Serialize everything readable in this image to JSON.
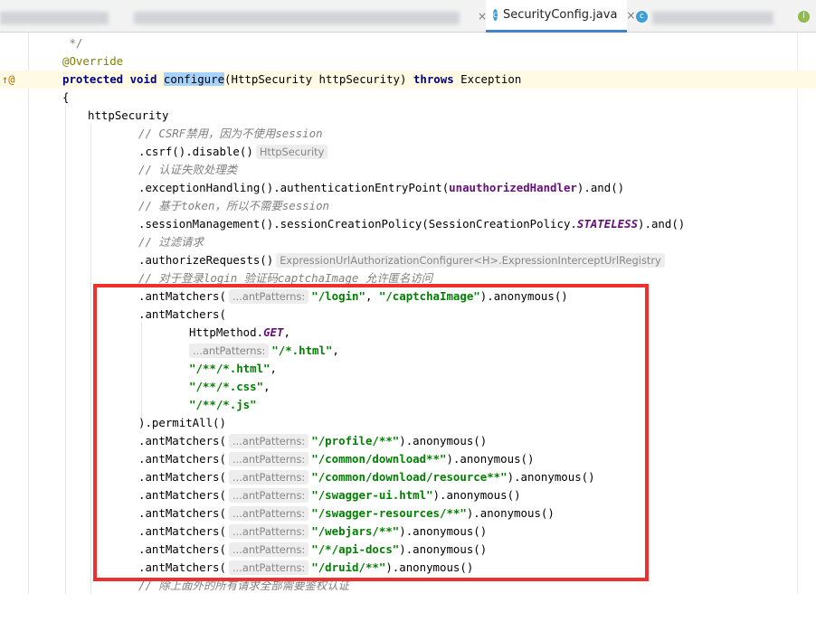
{
  "tabs": [
    {
      "label": "",
      "blurred": true
    },
    {
      "label": "",
      "blurred": true
    },
    {
      "label": "SecurityConfig.java",
      "active": true
    },
    {
      "label": "",
      "blurred": true
    }
  ],
  "tab_close_glyph": "×",
  "gutter": {
    "override_mark": "↑@"
  },
  "lines": [
    {
      "text": " */"
    },
    {
      "annotation": "@Override"
    },
    {
      "kw1": "protected void ",
      "method": "configure",
      "rest1": "(HttpSecurity httpSecurity) ",
      "kw2": "throws",
      "rest2": " Exception"
    },
    {
      "text": "{"
    },
    {
      "text": "httpSecurity"
    },
    {
      "comment": "// CSRF禁用，因为不使用session"
    },
    {
      "text": ".csrf().disable()",
      "hint": "HttpSecurity"
    },
    {
      "comment": "// 认证失败处理类"
    },
    {
      "pre": ".exceptionHandling().authenticationEntryPoint(",
      "field": "unauthorizedHandler",
      "post": ").and()"
    },
    {
      "comment": "// 基于token，所以不需要session"
    },
    {
      "pre": ".sessionManagement().sessionCreationPolicy(SessionCreationPolicy.",
      "sfield": "STATELESS",
      "post": ").and()"
    },
    {
      "comment": "// 过滤请求"
    },
    {
      "text": ".authorizeRequests()",
      "hint": "ExpressionUrlAuthorizationConfigurer<H>.ExpressionInterceptUrlRegistry"
    },
    {
      "comment": "// 对于登录login 验证码captchaImage 允许匿名访问"
    },
    {
      "pre": ".antMatchers(",
      "hint": "...antPatterns:",
      "str1": "\"/login\"",
      "mid": ", ",
      "str2": "\"/captchaImage\"",
      "post": ").anonymous()"
    },
    {
      "text": ".antMatchers("
    },
    {
      "pre": "HttpMethod.",
      "sfield": "GET",
      "post": ","
    },
    {
      "hint": "...antPatterns:",
      "str1": "\"/*.html\"",
      "post": ","
    },
    {
      "str1": "\"/**/*.html\"",
      "post": ","
    },
    {
      "str1": "\"/**/*.css\"",
      "post": ","
    },
    {
      "str1": "\"/**/*.js\""
    },
    {
      "text": ").permitAll()"
    },
    {
      "pre": ".antMatchers(",
      "hint": "...antPatterns:",
      "str1": "\"/profile/**\"",
      "post": ").anonymous()"
    },
    {
      "pre": ".antMatchers(",
      "hint": "...antPatterns:",
      "str1": "\"/common/download**\"",
      "post": ").anonymous()"
    },
    {
      "pre": ".antMatchers(",
      "hint": "...antPatterns:",
      "str1": "\"/common/download/resource**\"",
      "post": ").anonymous()"
    },
    {
      "pre": ".antMatchers(",
      "hint": "...antPatterns:",
      "str1": "\"/swagger-ui.html\"",
      "post": ").anonymous()"
    },
    {
      "pre": ".antMatchers(",
      "hint": "...antPatterns:",
      "str1": "\"/swagger-resources/**\"",
      "post": ").anonymous()"
    },
    {
      "pre": ".antMatchers(",
      "hint": "...antPatterns:",
      "str1": "\"/webjars/**\"",
      "post": ").anonymous()"
    },
    {
      "pre": ".antMatchers(",
      "hint": "...antPatterns:",
      "str1": "\"/*/api-docs\"",
      "post": ").anonymous()"
    },
    {
      "pre": ".antMatchers(",
      "hint": "...antPatterns:",
      "str1": "\"/druid/**\"",
      "post": ").anonymous()"
    },
    {
      "comment": "// 除上面外的所有请求全部需要鉴权认证"
    }
  ]
}
